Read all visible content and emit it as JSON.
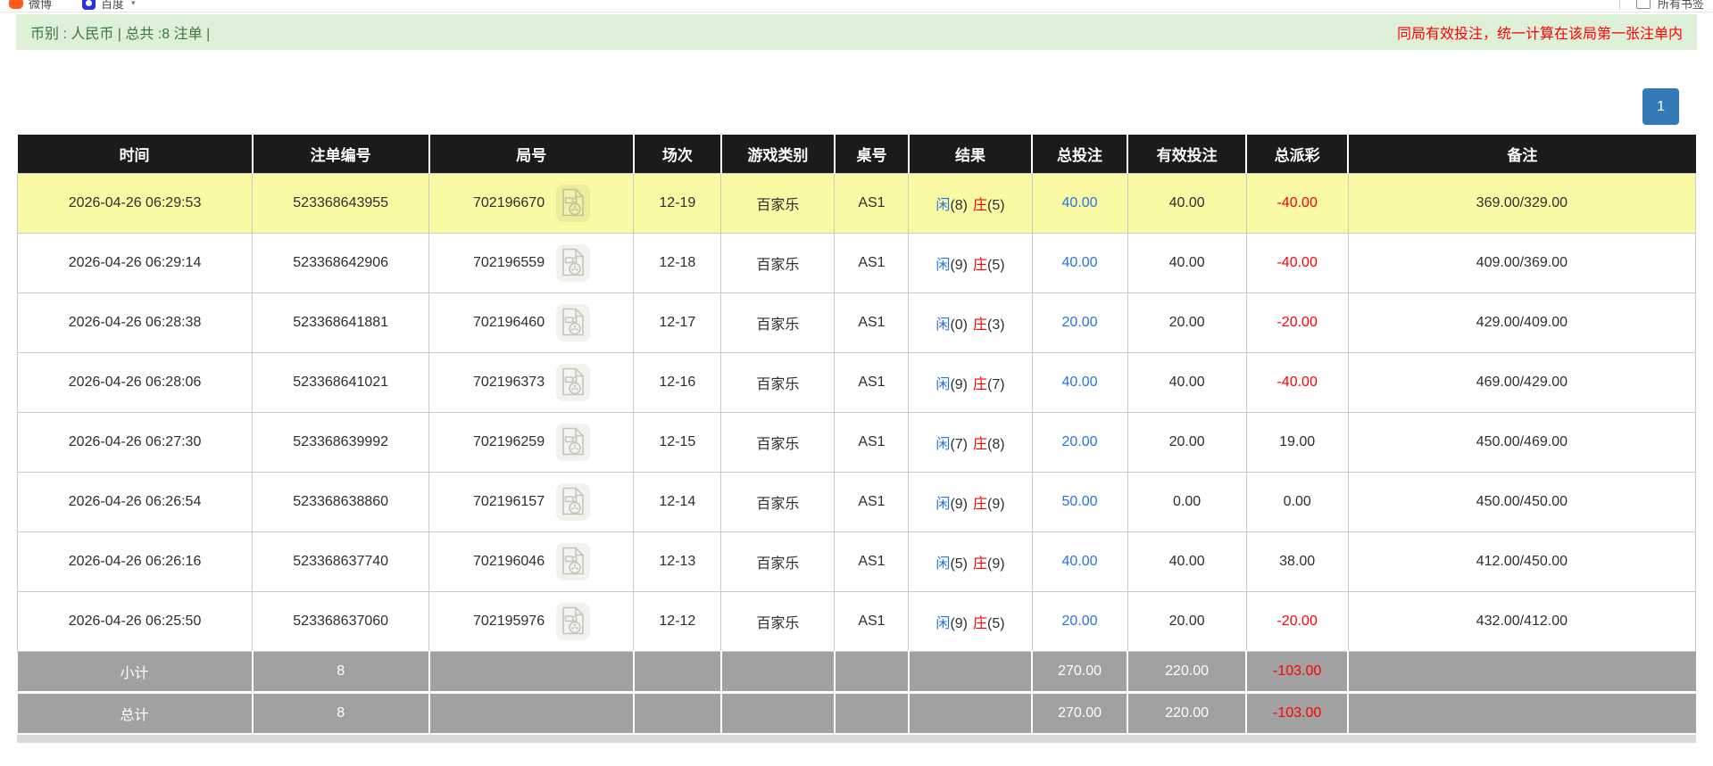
{
  "browser_bar": {
    "bookmarks": [
      {
        "icon": "chat-bubble-icon",
        "label": "微博"
      },
      {
        "icon": "baidu-icon",
        "label": "百度"
      }
    ],
    "all_bookmarks_label": "所有书签"
  },
  "info_bar": {
    "left_text": "币别 : 人民币 | 总共 :8 注单 |",
    "right_notice": "同局有效投注，统一计算在该局第一张注单内"
  },
  "pagination": {
    "page": "1"
  },
  "table": {
    "headers": [
      "时间",
      "注单编号",
      "局号",
      "场次",
      "游戏类别",
      "桌号",
      "结果",
      "总投注",
      "有效投注",
      "总派彩",
      "备注"
    ],
    "rows": [
      {
        "time": "2026-04-26 06:29:53",
        "bet_id": "523368643955",
        "round_id": "702196670",
        "session": "12-19",
        "game_type": "百家乐",
        "table_no": "AS1",
        "result": {
          "player": "闲",
          "player_pts": "(8)",
          "banker": "庄",
          "banker_pts": "(5)"
        },
        "total_bet": "40.00",
        "valid_bet": "40.00",
        "payout": "-40.00",
        "remark": "369.00/329.00",
        "highlighted": true
      },
      {
        "time": "2026-04-26 06:29:14",
        "bet_id": "523368642906",
        "round_id": "702196559",
        "session": "12-18",
        "game_type": "百家乐",
        "table_no": "AS1",
        "result": {
          "player": "闲",
          "player_pts": "(9)",
          "banker": "庄",
          "banker_pts": "(5)"
        },
        "total_bet": "40.00",
        "valid_bet": "40.00",
        "payout": "-40.00",
        "remark": "409.00/369.00",
        "highlighted": false
      },
      {
        "time": "2026-04-26 06:28:38",
        "bet_id": "523368641881",
        "round_id": "702196460",
        "session": "12-17",
        "game_type": "百家乐",
        "table_no": "AS1",
        "result": {
          "player": "闲",
          "player_pts": "(0)",
          "banker": "庄",
          "banker_pts": "(3)"
        },
        "total_bet": "20.00",
        "valid_bet": "20.00",
        "payout": "-20.00",
        "remark": "429.00/409.00",
        "highlighted": false
      },
      {
        "time": "2026-04-26 06:28:06",
        "bet_id": "523368641021",
        "round_id": "702196373",
        "session": "12-16",
        "game_type": "百家乐",
        "table_no": "AS1",
        "result": {
          "player": "闲",
          "player_pts": "(9)",
          "banker": "庄",
          "banker_pts": "(7)"
        },
        "total_bet": "40.00",
        "valid_bet": "40.00",
        "payout": "-40.00",
        "remark": "469.00/429.00",
        "highlighted": false
      },
      {
        "time": "2026-04-26 06:27:30",
        "bet_id": "523368639992",
        "round_id": "702196259",
        "session": "12-15",
        "game_type": "百家乐",
        "table_no": "AS1",
        "result": {
          "player": "闲",
          "player_pts": "(7)",
          "banker": "庄",
          "banker_pts": "(8)"
        },
        "total_bet": "20.00",
        "valid_bet": "20.00",
        "payout": "19.00",
        "remark": "450.00/469.00",
        "highlighted": false
      },
      {
        "time": "2026-04-26 06:26:54",
        "bet_id": "523368638860",
        "round_id": "702196157",
        "session": "12-14",
        "game_type": "百家乐",
        "table_no": "AS1",
        "result": {
          "player": "闲",
          "player_pts": "(9)",
          "banker": "庄",
          "banker_pts": "(9)"
        },
        "total_bet": "50.00",
        "valid_bet": "0.00",
        "payout": "0.00",
        "remark": "450.00/450.00",
        "highlighted": false
      },
      {
        "time": "2026-04-26 06:26:16",
        "bet_id": "523368637740",
        "round_id": "702196046",
        "session": "12-13",
        "game_type": "百家乐",
        "table_no": "AS1",
        "result": {
          "player": "闲",
          "player_pts": "(5)",
          "banker": "庄",
          "banker_pts": "(9)"
        },
        "total_bet": "40.00",
        "valid_bet": "40.00",
        "payout": "38.00",
        "remark": "412.00/450.00",
        "highlighted": false
      },
      {
        "time": "2026-04-26 06:25:50",
        "bet_id": "523368637060",
        "round_id": "702195976",
        "session": "12-12",
        "game_type": "百家乐",
        "table_no": "AS1",
        "result": {
          "player": "闲",
          "player_pts": "(9)",
          "banker": "庄",
          "banker_pts": "(5)"
        },
        "total_bet": "20.00",
        "valid_bet": "20.00",
        "payout": "-20.00",
        "remark": "432.00/412.00",
        "highlighted": false
      }
    ],
    "subtotal": {
      "label": "小计",
      "count": "8",
      "total_bet": "270.00",
      "valid_bet": "220.00",
      "payout": "-103.00"
    },
    "grandtotal": {
      "label": "总计",
      "count": "8",
      "total_bet": "270.00",
      "valid_bet": "220.00",
      "payout": "-103.00"
    }
  },
  "colors": {
    "blue": "#2673e8",
    "red": "#ff0000",
    "header_bg": "#1b1b1b",
    "row_highlight": "#fafaa5",
    "summary_bg": "#a1a1a1",
    "page_btn": "#337ab7",
    "info_bg": "#dff0d8",
    "info_text": "#3c763d"
  }
}
